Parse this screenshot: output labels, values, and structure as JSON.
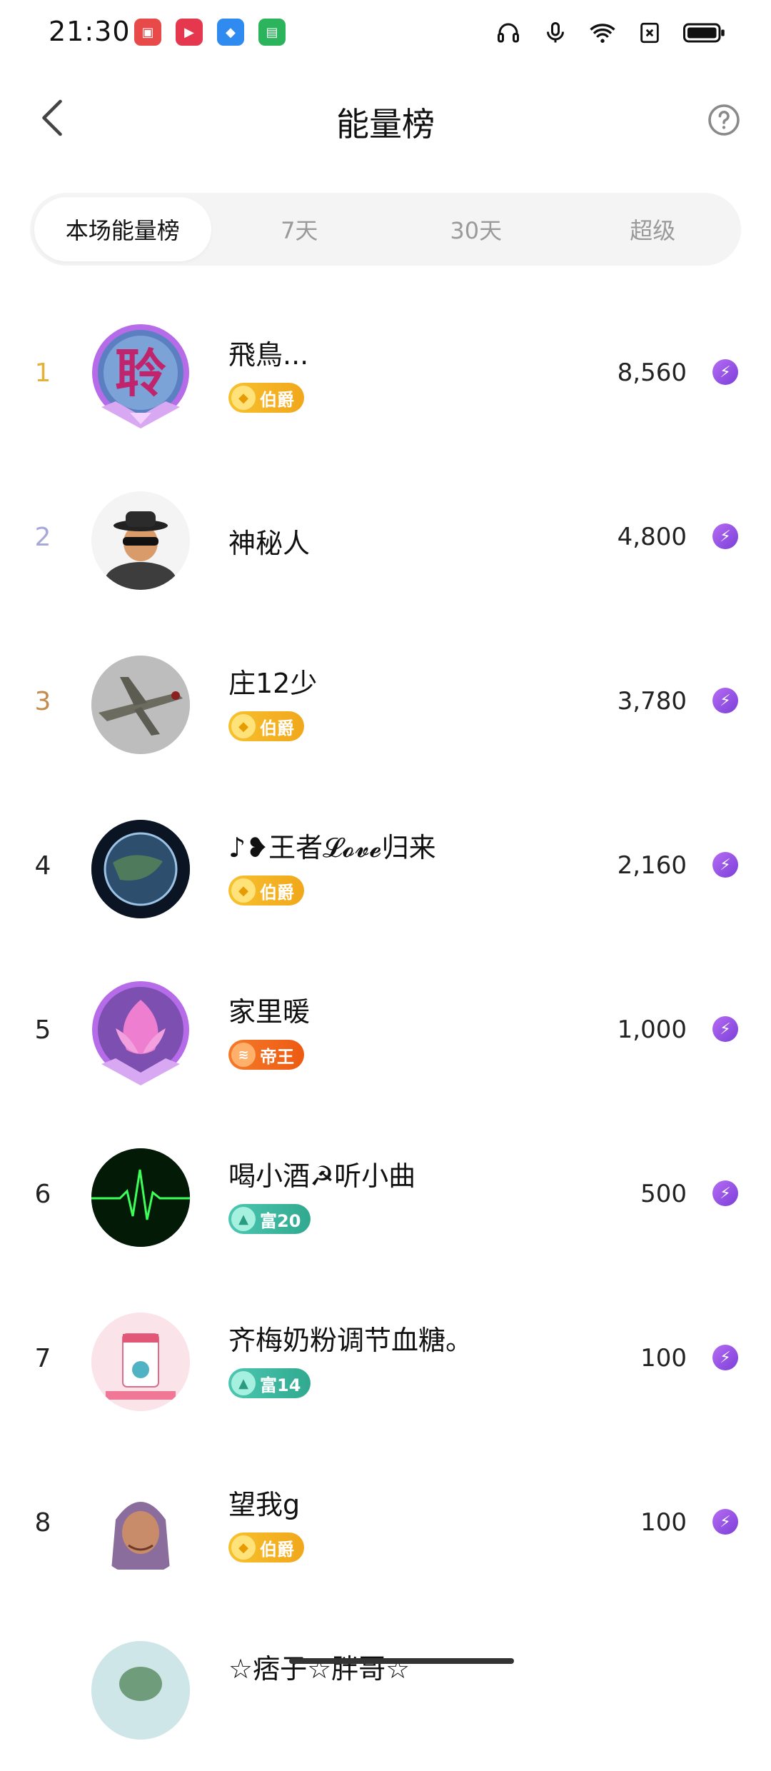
{
  "status_bar": {
    "time": "21:30",
    "app_icons": [
      {
        "icon": "app-icon-red-tv",
        "color": "#e84a4a"
      },
      {
        "icon": "app-icon-video",
        "color": "#e5384e"
      },
      {
        "icon": "app-icon-blue",
        "color": "#2f8bf0"
      },
      {
        "icon": "app-icon-green-bag",
        "color": "#2bb45b"
      }
    ],
    "icons": [
      "headphones-icon",
      "mic-icon",
      "wifi-icon",
      "sim-off-icon",
      "battery-icon"
    ]
  },
  "header": {
    "title": "能量榜",
    "back_icon": "chevron-left-icon",
    "help_icon": "question-circle-icon"
  },
  "tabs": [
    {
      "label": "本场能量榜",
      "active": true
    },
    {
      "label": "7天",
      "active": false
    },
    {
      "label": "30天",
      "active": false
    },
    {
      "label": "超级",
      "active": false
    }
  ],
  "colors": {
    "rank1": "#e4b23a",
    "rank2": "#a7a8d8",
    "rank3": "#c48a4e",
    "energy": "#8b4de0",
    "badge_gold": "#f0b429",
    "badge_emperor": "#f06a1e",
    "badge_rich": "#3fb7a0"
  },
  "leaderboard": [
    {
      "rank": "1",
      "name": "飛鳥...",
      "score": "8,560",
      "badge": "伯爵",
      "badge_type": "gold"
    },
    {
      "rank": "2",
      "name": "神秘人",
      "score": "4,800",
      "badge": "",
      "badge_type": "none"
    },
    {
      "rank": "3",
      "name": "庄12少",
      "score": "3,780",
      "badge": "伯爵",
      "badge_type": "gold"
    },
    {
      "rank": "4",
      "name": "♪❥王者𝓛𝓸𝓿𝓮归来",
      "score": "2,160",
      "badge": "伯爵",
      "badge_type": "gold"
    },
    {
      "rank": "5",
      "name": "家里暖",
      "score": "1,000",
      "badge": "帝王",
      "badge_type": "emperor"
    },
    {
      "rank": "6",
      "name": "喝小酒☭听小曲",
      "score": "500",
      "badge": "富20",
      "badge_type": "rich"
    },
    {
      "rank": "7",
      "name": "齐梅奶粉调节血糖。",
      "score": "100",
      "badge": "富14",
      "badge_type": "rich"
    },
    {
      "rank": "8",
      "name": "望我g",
      "score": "100",
      "badge": "伯爵",
      "badge_type": "gold"
    },
    {
      "rank": "",
      "name": "☆痞子☆胖哥☆",
      "score": "",
      "badge": "",
      "badge_type": "none"
    }
  ]
}
